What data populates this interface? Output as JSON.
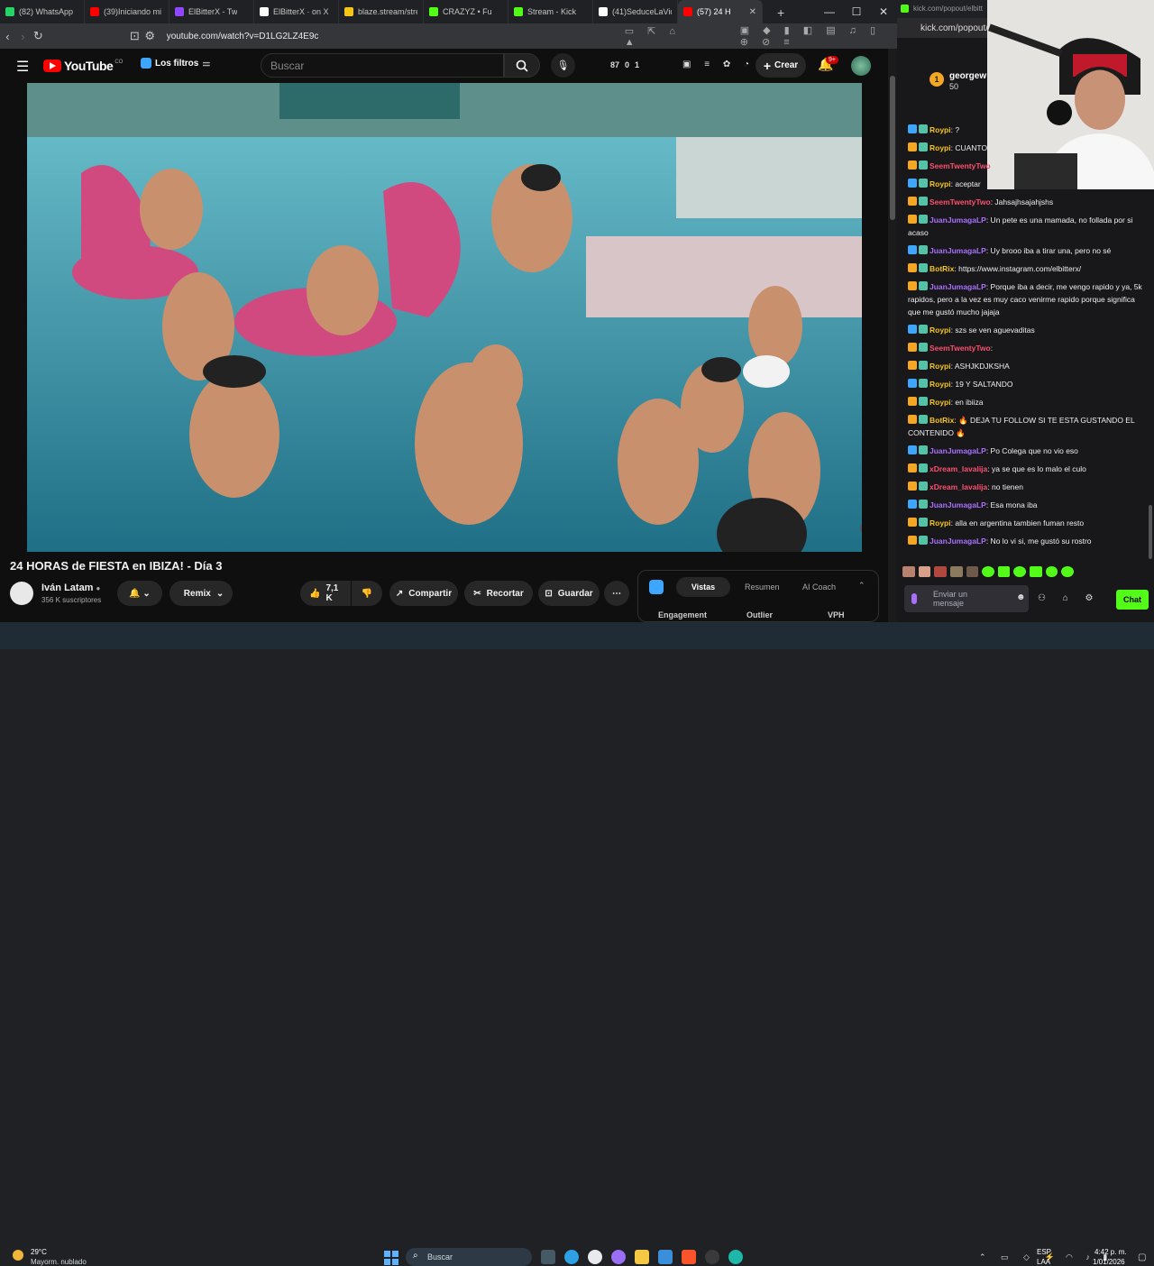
{
  "browser": {
    "tabs": [
      {
        "label": "(82) WhatsApp",
        "color": "#25d366"
      },
      {
        "label": "(39)Iniciando mi",
        "color": "#ff0000"
      },
      {
        "label": "ElBitterX - Tw",
        "color": "#9146ff"
      },
      {
        "label": "ElBitterX · on X",
        "color": "#ffffff"
      },
      {
        "label": "blaze.stream/stre",
        "color": "#f5c518"
      },
      {
        "label": "CRAZYZ • Fu",
        "color": "#53fc18"
      },
      {
        "label": "Stream - Kick",
        "color": "#53fc18"
      },
      {
        "label": "(41)SeduceLaVid",
        "color": "#ffffff"
      },
      {
        "label": "(57) 24 H",
        "color": "#ff0000"
      }
    ],
    "new_tab": "+",
    "url": "youtube.com/watch?v=D1LG2LZ4E9c"
  },
  "youtube": {
    "logo": "YouTube",
    "logo_region": "CO",
    "filters_label": "Los filtros",
    "search_placeholder": "Buscar",
    "stats": [
      "87",
      "0",
      "1"
    ],
    "create_label": "Crear",
    "notif_count": "9+",
    "video_title": "24 HORAS de FIESTA en IBIZA! - Día 3",
    "channel_name": "Iván Latam",
    "subscribers": "356 K suscriptores",
    "remix_label": "Remix",
    "like_count": "7,1 K",
    "share_label": "Compartir",
    "clip_label": "Recortar",
    "save_label": "Guardar",
    "more_label": "⋯",
    "panel_tabs": [
      "Vistas",
      "Resumen",
      "AI Coach"
    ],
    "panel_cols": [
      "Engagement",
      "Outlier",
      "VPH"
    ]
  },
  "twitch": {
    "popout_url": "kick.com/popout/elbitt",
    "popout_url_2": "kick.com/popout/",
    "top_user": "georgew",
    "top_user_count": "50",
    "messages": [
      {
        "user": "Roypi",
        "color": "#f5c518",
        "text": ": ?"
      },
      {
        "user": "Roypi",
        "color": "#f5c518",
        "text": ": CUANTO"
      },
      {
        "user": "SeemTwentyTwo",
        "color": "#ff4f6d",
        "text": ""
      },
      {
        "user": "Roypi",
        "color": "#f5c518",
        "text": ": aceptar"
      },
      {
        "user": "SeemTwentyTwo",
        "color": "#ff4f6d",
        "text": ": Jahsajhsajahjshs"
      },
      {
        "user": "JuanJumagaLP",
        "color": "#a970ff",
        "text": ": Un pete es una mamada, no follada por si acaso"
      },
      {
        "user": "JuanJumagaLP",
        "color": "#a970ff",
        "text": ": Uy brooo iba a tirar una, pero no sé"
      },
      {
        "user": "BotRix",
        "color": "#f5c518",
        "text": ": https://www.instagram.com/elbitterx/"
      },
      {
        "user": "JuanJumagaLP",
        "color": "#a970ff",
        "text": ": Porque iba a decir, me vengo rapido y ya, 5k rapidos, pero a la vez es muy caco venirme rapido porque significa que me gustó mucho jajaja"
      },
      {
        "user": "Roypi",
        "color": "#f5c518",
        "text": ": szs se ven aguevaditas"
      },
      {
        "user": "SeemTwentyTwo",
        "color": "#ff4f6d",
        "text": ":"
      },
      {
        "user": "Roypi",
        "color": "#f5c518",
        "text": ": ASHJKDJKSHA"
      },
      {
        "user": "Roypi",
        "color": "#f5c518",
        "text": ": 19 Y SALTANDO"
      },
      {
        "user": "Roypi",
        "color": "#f5c518",
        "text": ": en ibiiza"
      },
      {
        "user": "BotRix",
        "color": "#f5c518",
        "text": ": 🔥 DEJA TU FOLLOW SI TE ESTA GUSTANDO EL CONTENIDO 🔥"
      },
      {
        "user": "JuanJumagaLP",
        "color": "#a970ff",
        "text": ": Po Colega que no vio eso"
      },
      {
        "user": "xDream_lavalija",
        "color": "#ff4f6d",
        "text": ": ya se que es lo malo el culo"
      },
      {
        "user": "xDream_lavalija",
        "color": "#ff4f6d",
        "text": ": no tienen"
      },
      {
        "user": "JuanJumagaLP",
        "color": "#a970ff",
        "text": ": Esa mona iba"
      },
      {
        "user": "Roypi",
        "color": "#f5c518",
        "text": ": alla en argentina tambien fuman resto"
      },
      {
        "user": "JuanJumagaLP",
        "color": "#a970ff",
        "text": ": No lo vi si, me gustó su rostro"
      }
    ],
    "chat_placeholder": "Enviar un mensaje",
    "chat_button": "Chat"
  },
  "taskbar": {
    "weather_temp": "29°C",
    "weather_desc": "Mayorm. nublado",
    "search_label": "Buscar",
    "lang": "ESP",
    "lang2": "LAA",
    "time": "4:42 p. m.",
    "date": "1/01/2026"
  }
}
